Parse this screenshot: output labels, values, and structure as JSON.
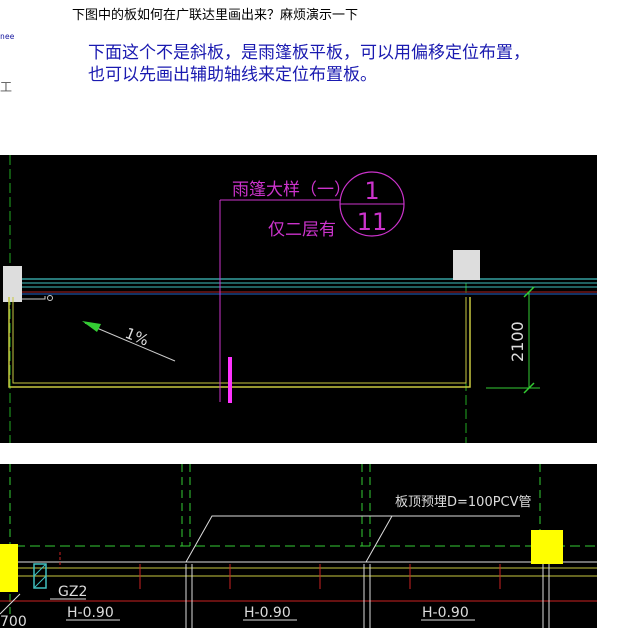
{
  "post": {
    "title": "下图中的板如何在广联达里画出来？麻烦演示一下",
    "side_text_1": "nee",
    "side_text_2": "工",
    "answer_lines": [
      "下面这个不是斜板，是雨篷板平板，可以用偏移定位布置，",
      "也可以先画出辅助轴线来定位布置板。"
    ]
  },
  "drawing1": {
    "detail_title": "雨篷大样（一）",
    "detail_note": "仅二层有",
    "detail_number": "1",
    "detail_sheet": "11",
    "slope_label": "1%",
    "dimension": "2100"
  },
  "drawing2": {
    "note": "板顶预埋D=100PCV管",
    "column_label": "GZ2",
    "partial_dim": "700",
    "elevation_labels": [
      "H-0.90",
      "H-0.90",
      "H-0.90"
    ]
  },
  "colors": {
    "cad_background": "#000000",
    "magenta": "#cc33cc",
    "wall": "#c8c840",
    "axis_green": "#33cc33",
    "cyan": "#40c0c0",
    "column_yellow": "#ffff00"
  }
}
